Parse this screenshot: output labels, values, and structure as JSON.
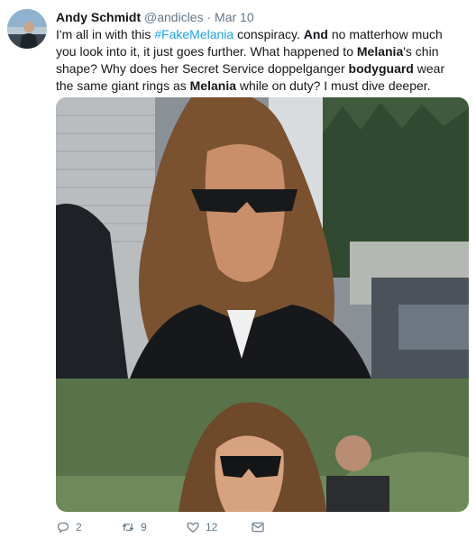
{
  "tweet": {
    "author_name": "Andy Schmidt",
    "handle": "@andicles",
    "separator": "·",
    "date": "Mar 10",
    "text": {
      "p1": "I'm all in with this ",
      "hashtag": "#FakeMelania",
      "p2": " conspiracy. ",
      "bold1": "And",
      "p3": " no matterhow much you look into it, it just goes further. What happened to ",
      "bold2": "Melania",
      "p4": "'s chin shape? Why does her Secret Service doppelganger ",
      "bold3": "bodyguard",
      "p5": " wear the same giant rings as ",
      "bold4": "Melania",
      "p6": " while on duty? I must dive deeper."
    }
  },
  "actions": {
    "reply_count": "2",
    "retweet_count": "9",
    "like_count": "12"
  },
  "colors": {
    "link": "#1da1f2",
    "meta": "#657786",
    "text": "#14171a"
  }
}
